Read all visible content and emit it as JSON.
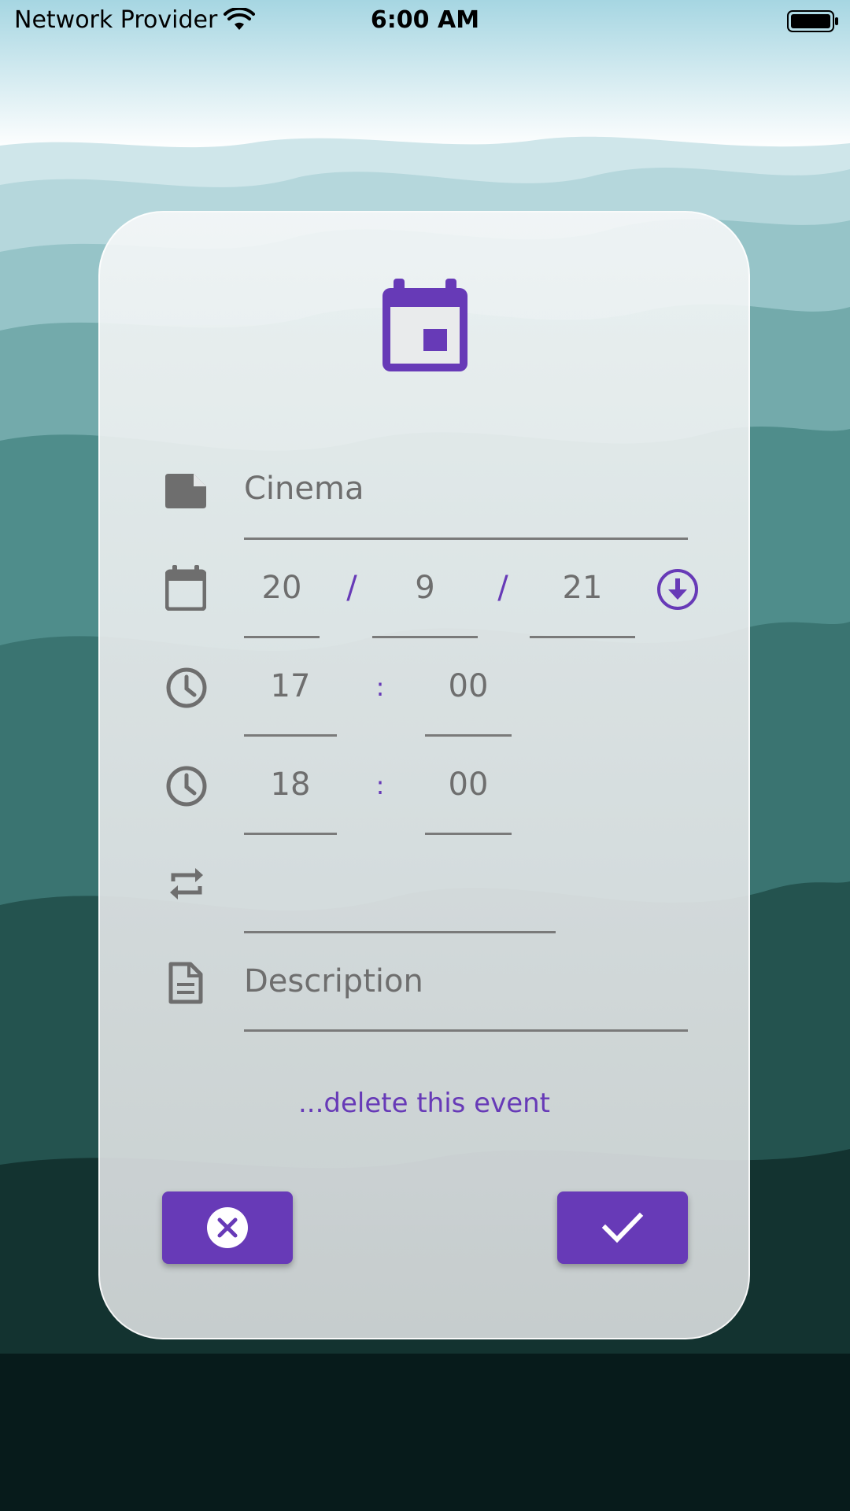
{
  "status_bar": {
    "provider": "Network Provider",
    "time": "6:00 AM"
  },
  "event_form": {
    "title_value": "Cinema",
    "date": {
      "day": "20",
      "month": "9",
      "year": "21",
      "separator": "/"
    },
    "start_time": {
      "hour": "17",
      "minute": "00",
      "separator": ":"
    },
    "end_time": {
      "hour": "18",
      "minute": "00",
      "separator": ":"
    },
    "repeat_value": "",
    "description_placeholder": "Description",
    "delete_link": "...delete this event"
  },
  "colors": {
    "accent": "#673ab7",
    "icon_gray": "#6e6e6e"
  },
  "icons": {
    "header": "calendar-icon",
    "title": "note-icon",
    "date": "calendar-outline-icon",
    "time": "clock-icon",
    "repeat": "repeat-icon",
    "description": "document-icon",
    "date_picker": "arrow-down-circle-icon",
    "cancel": "close-circle-icon",
    "confirm": "check-icon"
  }
}
